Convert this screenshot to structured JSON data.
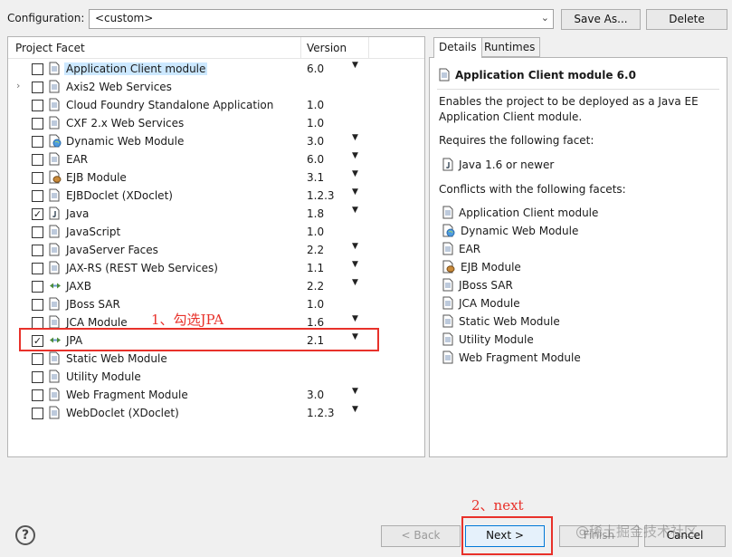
{
  "configuration": {
    "label": "Configuration:",
    "value": "<custom>",
    "save_as_label": "Save As...",
    "delete_label": "Delete"
  },
  "facets_table": {
    "header_facet": "Project Facet",
    "header_version": "Version",
    "rows": [
      {
        "name": "Application Client module",
        "version": "6.0",
        "checked": false,
        "dropdown": true,
        "icon": "page-icon",
        "expander": false,
        "selected": true
      },
      {
        "name": "Axis2 Web Services",
        "version": "",
        "checked": false,
        "dropdown": false,
        "icon": "page-icon",
        "expander": true,
        "selected": false
      },
      {
        "name": "Cloud Foundry Standalone Application",
        "version": "1.0",
        "checked": false,
        "dropdown": false,
        "icon": "page-icon",
        "expander": false,
        "selected": false
      },
      {
        "name": "CXF 2.x Web Services",
        "version": "1.0",
        "checked": false,
        "dropdown": false,
        "icon": "page-icon",
        "expander": false,
        "selected": false
      },
      {
        "name": "Dynamic Web Module",
        "version": "3.0",
        "checked": false,
        "dropdown": true,
        "icon": "web-module-icon",
        "expander": false,
        "selected": false
      },
      {
        "name": "EAR",
        "version": "6.0",
        "checked": false,
        "dropdown": true,
        "icon": "page-icon",
        "expander": false,
        "selected": false
      },
      {
        "name": "EJB Module",
        "version": "3.1",
        "checked": false,
        "dropdown": true,
        "icon": "ejb-bean-icon",
        "expander": false,
        "selected": false
      },
      {
        "name": "EJBDoclet (XDoclet)",
        "version": "1.2.3",
        "checked": false,
        "dropdown": true,
        "icon": "page-icon",
        "expander": false,
        "selected": false
      },
      {
        "name": "Java",
        "version": "1.8",
        "checked": true,
        "dropdown": true,
        "icon": "java-icon",
        "expander": false,
        "selected": false
      },
      {
        "name": "JavaScript",
        "version": "1.0",
        "checked": false,
        "dropdown": false,
        "icon": "page-icon",
        "expander": false,
        "selected": false
      },
      {
        "name": "JavaServer Faces",
        "version": "2.2",
        "checked": false,
        "dropdown": true,
        "icon": "page-icon",
        "expander": false,
        "selected": false
      },
      {
        "name": "JAX-RS (REST Web Services)",
        "version": "1.1",
        "checked": false,
        "dropdown": true,
        "icon": "page-icon",
        "expander": false,
        "selected": false
      },
      {
        "name": "JAXB",
        "version": "2.2",
        "checked": false,
        "dropdown": true,
        "icon": "jpa-arrows-icon",
        "expander": false,
        "selected": false
      },
      {
        "name": "JBoss SAR",
        "version": "1.0",
        "checked": false,
        "dropdown": false,
        "icon": "page-icon",
        "expander": false,
        "selected": false
      },
      {
        "name": "JCA Module",
        "version": "1.6",
        "checked": false,
        "dropdown": true,
        "icon": "page-icon",
        "expander": false,
        "selected": false
      },
      {
        "name": "JPA",
        "version": "2.1",
        "checked": true,
        "dropdown": true,
        "icon": "jpa-arrows-icon",
        "expander": false,
        "selected": false
      },
      {
        "name": "Static Web Module",
        "version": "",
        "checked": false,
        "dropdown": false,
        "icon": "page-icon",
        "expander": false,
        "selected": false
      },
      {
        "name": "Utility Module",
        "version": "",
        "checked": false,
        "dropdown": false,
        "icon": "page-icon",
        "expander": false,
        "selected": false
      },
      {
        "name": "Web Fragment Module",
        "version": "3.0",
        "checked": false,
        "dropdown": true,
        "icon": "page-icon",
        "expander": false,
        "selected": false
      },
      {
        "name": "WebDoclet (XDoclet)",
        "version": "1.2.3",
        "checked": false,
        "dropdown": true,
        "icon": "page-icon",
        "expander": false,
        "selected": false
      }
    ]
  },
  "details": {
    "tab_details": "Details",
    "tab_runtimes": "Runtimes",
    "title": "Application Client module 6.0",
    "description": "Enables the project to be deployed as a Java EE Application Client module.",
    "requires_label": "Requires the following facet:",
    "requires": [
      {
        "name": "Java 1.6 or newer",
        "icon": "java-icon"
      }
    ],
    "conflicts_label": "Conflicts with the following facets:",
    "conflicts": [
      {
        "name": "Application Client module",
        "icon": "page-icon"
      },
      {
        "name": "Dynamic Web Module",
        "icon": "web-module-icon"
      },
      {
        "name": "EAR",
        "icon": "page-icon"
      },
      {
        "name": "EJB Module",
        "icon": "ejb-bean-icon"
      },
      {
        "name": "JBoss SAR",
        "icon": "page-icon"
      },
      {
        "name": "JCA Module",
        "icon": "page-icon"
      },
      {
        "name": "Static Web Module",
        "icon": "page-icon"
      },
      {
        "name": "Utility Module",
        "icon": "page-icon"
      },
      {
        "name": "Web Fragment Module",
        "icon": "page-icon"
      }
    ]
  },
  "annotations": {
    "step1": "1、勾选JPA",
    "step2": "2、next",
    "color": "#e8312a"
  },
  "footer": {
    "help_symbol": "?",
    "back_label": "< Back",
    "next_label": "Next >",
    "finish_label": "Finish",
    "cancel_label": "Cancel"
  },
  "watermark": "@稀土掘金技术社区"
}
